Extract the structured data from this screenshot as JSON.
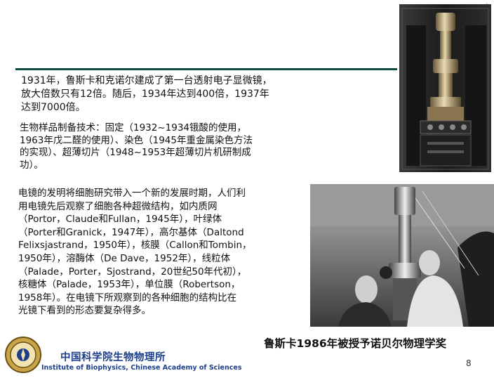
{
  "paragraphs": {
    "p1": [
      "1931年，鲁斯卡和克诺尔建成了第一台透射电子显微镜，",
      "放大倍数只有12倍。随后，1934年达到400倍，1937年",
      "达到7000倍。"
    ],
    "p2": [
      "生物样品制备技术：固定（1932~1934锇酸的使用，",
      "1963年戊二醛的使用）、染色（1945年重金属染色方法",
      "的实现）、超薄切片（1948~1953年超薄切片机研制成",
      "功）。"
    ],
    "p3": [
      "电镜的发明将细胞研究带入一个新的发展时期，人们利",
      "用电镜先后观察了细胞各种超微结构，如内质网",
      "（Portor，Claude和Fullan，1945年），叶绿体",
      "（Porter和Granick，1947年），高尔基体（Daltond",
      "Felixsjastrand，1950年），核膜（Callon和Tombin，",
      "1950年），溶酶体（De Dave，1952年），线粒体",
      "（Palade，Porter，Sjostrand，20世纪50年代初），",
      "核糖体（Palade，1953年），单位膜（Robertson，",
      "1958年）。在电镜下所观察到的各种细胞的结构比在",
      "光镜下看到的形态要复杂得多。"
    ]
  },
  "caption": "鲁斯卡1986年被授予诺贝尔物理学奖",
  "institute": {
    "name_cn": "中国科学院生物物理所",
    "name_en": "Institute of Biophysics, Chinese Academy of Sciences"
  },
  "page_number": "8",
  "colors": {
    "rule": "#0f4b45",
    "institute": "#1d3f8a"
  },
  "icons": {
    "logo": "institute-seal-icon",
    "corner": "star-icon"
  }
}
